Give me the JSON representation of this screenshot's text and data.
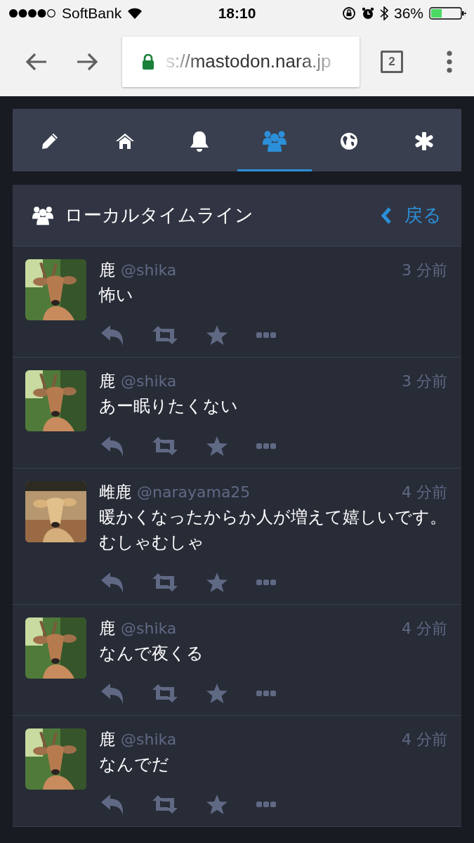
{
  "status_bar": {
    "carrier": "SoftBank",
    "time": "18:10",
    "battery": "36%"
  },
  "browser": {
    "url": "s://mastodon.nara.jp",
    "tab_count": "2"
  },
  "nav_tabs": [
    {
      "kind": "compose",
      "selected": false
    },
    {
      "kind": "home",
      "selected": false
    },
    {
      "kind": "notifications",
      "selected": false
    },
    {
      "kind": "local",
      "selected": true
    },
    {
      "kind": "federated",
      "selected": false
    },
    {
      "kind": "settings",
      "selected": false
    }
  ],
  "column": {
    "title": "ローカルタイムライン",
    "back": "戻る"
  },
  "statuses": [
    {
      "name": "鹿",
      "handle": "@shika",
      "time": "3 分前",
      "text": "怖い"
    },
    {
      "name": "鹿",
      "handle": "@shika",
      "time": "3 分前",
      "text": "あー眠りたくない"
    },
    {
      "name": "雌鹿",
      "handle": "@narayama25",
      "time": "4 分前",
      "text": "暖かくなったからか人が増えて嬉しいです。むしゃむしゃ"
    },
    {
      "name": "鹿",
      "handle": "@shika",
      "time": "4 分前",
      "text": "なんで夜くる"
    },
    {
      "name": "鹿",
      "handle": "@shika",
      "time": "4 分前",
      "text": "なんでだ"
    }
  ]
}
